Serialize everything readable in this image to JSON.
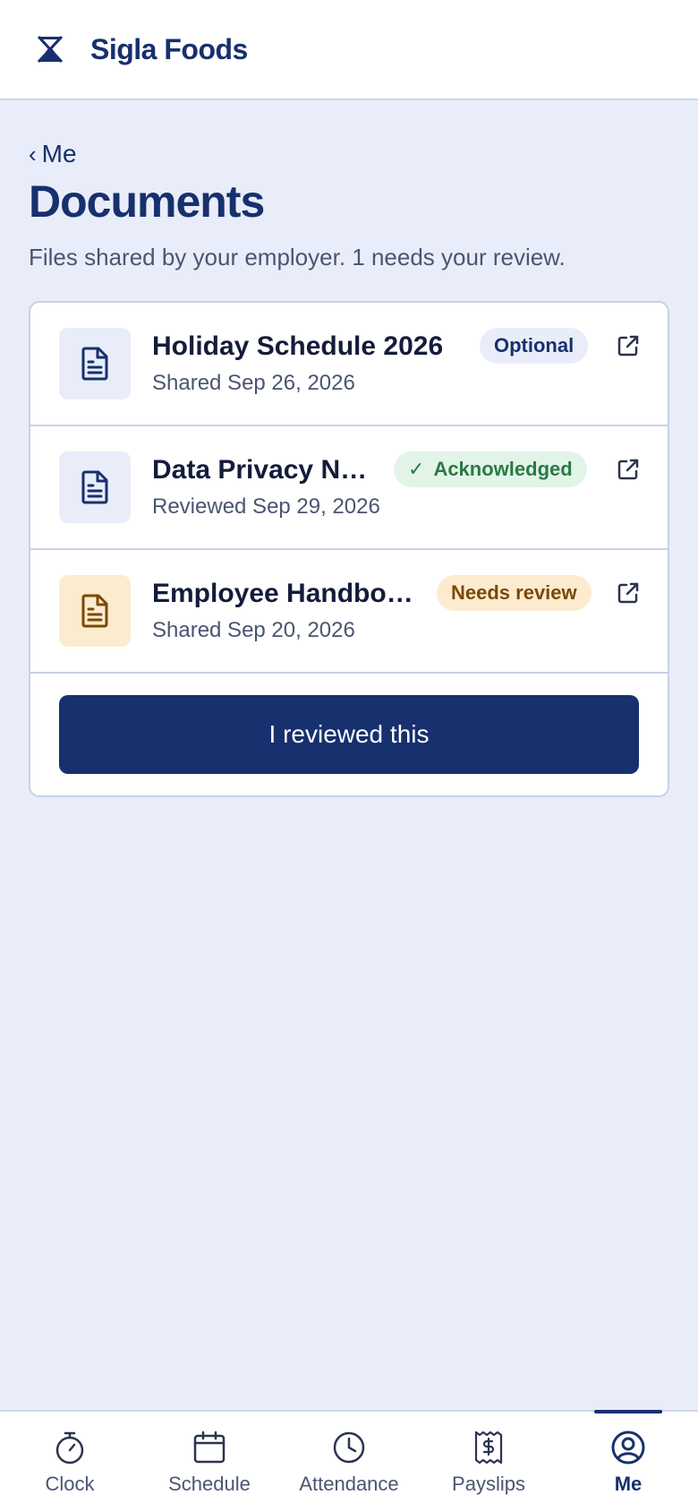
{
  "header": {
    "logo_icon": "hourglass-x-logo-icon",
    "brand": "Sigla Foods"
  },
  "nav": {
    "back_chevron": "‹",
    "back_label": "Me"
  },
  "page": {
    "title": "Documents",
    "subtitle": "Files shared by your employer. 1 needs your review."
  },
  "documents": [
    {
      "name": "Holiday Schedule 2026",
      "meta": "Shared Sep 26, 2026",
      "badge": "Optional",
      "badge_style": "optional",
      "icon": "document-icon",
      "icon_tone": "blue"
    },
    {
      "name": "Data Privacy Notice",
      "meta": "Reviewed Sep 29, 2026",
      "badge": "Acknowledged",
      "badge_check": "✓",
      "badge_style": "ack",
      "icon": "document-icon",
      "icon_tone": "blue"
    },
    {
      "name": "Employee Handbook",
      "meta": "Shared Sep 20, 2026",
      "badge": "Needs review",
      "badge_style": "review",
      "icon": "document-icon",
      "icon_tone": "amber"
    }
  ],
  "actions": {
    "review_button": "I reviewed this"
  },
  "tabbar": {
    "tabs": [
      {
        "label": "Clock",
        "icon": "stopwatch-icon"
      },
      {
        "label": "Schedule",
        "icon": "calendar-icon"
      },
      {
        "label": "Attendance",
        "icon": "clock-icon"
      },
      {
        "label": "Payslips",
        "icon": "receipt-dollar-icon"
      },
      {
        "label": "Me",
        "icon": "user-circle-icon",
        "active": true
      }
    ]
  },
  "colors": {
    "primary": "#17306e",
    "background": "#e9edf9",
    "ack_green": "#2a7a45",
    "review_amber": "#7a4a05"
  }
}
